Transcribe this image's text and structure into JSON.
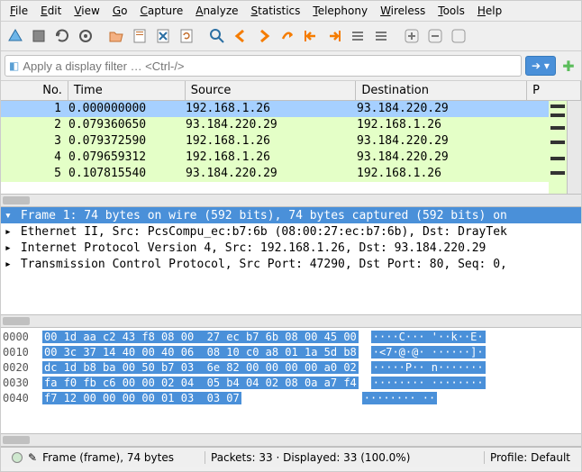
{
  "menu": [
    "File",
    "Edit",
    "View",
    "Go",
    "Capture",
    "Analyze",
    "Statistics",
    "Telephony",
    "Wireless",
    "Tools",
    "Help"
  ],
  "toolbar_icons": [
    "fin-icon",
    "stop-icon",
    "restart-icon",
    "options-icon",
    "open-icon",
    "save-icon",
    "close-icon",
    "reload-icon",
    "find-icon",
    "prev-icon",
    "next-icon",
    "jump-icon",
    "first-icon",
    "last-icon",
    "autoscroll-icon",
    "colorize-icon",
    "zoom-in-icon",
    "zoom-out-icon",
    "zoom-reset-icon"
  ],
  "filter": {
    "placeholder": "Apply a display filter … <Ctrl-/>"
  },
  "columns": {
    "no": "No.",
    "time": "Time",
    "src": "Source",
    "dst": "Destination",
    "proto": "P"
  },
  "packets": [
    {
      "no": "1",
      "time": "0.000000000",
      "src": "192.168.1.26",
      "dst": "93.184.220.29",
      "sel": true
    },
    {
      "no": "2",
      "time": "0.079360650",
      "src": "93.184.220.29",
      "dst": "192.168.1.26",
      "sel": false
    },
    {
      "no": "3",
      "time": "0.079372590",
      "src": "192.168.1.26",
      "dst": "93.184.220.29",
      "sel": false
    },
    {
      "no": "4",
      "time": "0.079659312",
      "src": "192.168.1.26",
      "dst": "93.184.220.29",
      "sel": false
    },
    {
      "no": "5",
      "time": "0.107815540",
      "src": "93.184.220.29",
      "dst": "192.168.1.26",
      "sel": false
    }
  ],
  "details": [
    {
      "text": "Frame 1: 74 bytes on wire (592 bits), 74 bytes captured (592 bits) on",
      "sel": true,
      "exp": true
    },
    {
      "text": "Ethernet II, Src: PcsCompu_ec:b7:6b (08:00:27:ec:b7:6b), Dst: DrayTek",
      "sel": false,
      "exp": false
    },
    {
      "text": "Internet Protocol Version 4, Src: 192.168.1.26, Dst: 93.184.220.29",
      "sel": false,
      "exp": false
    },
    {
      "text": "Transmission Control Protocol, Src Port: 47290, Dst Port: 80, Seq: 0,",
      "sel": false,
      "exp": false
    }
  ],
  "bytes": [
    {
      "off": "0000",
      "hex": "00 1d aa c2 43 f8 08 00  27 ec b7 6b 08 00 45 00",
      "asc": "····C··· '··k··E·"
    },
    {
      "off": "0010",
      "hex": "00 3c 37 14 40 00 40 06  08 10 c0 a8 01 1a 5d b8",
      "asc": "·<7·@·@· ······]·"
    },
    {
      "off": "0020",
      "hex": "dc 1d b8 ba 00 50 b7 03  6e 82 00 00 00 00 a0 02",
      "asc": "·····P·· n·······"
    },
    {
      "off": "0030",
      "hex": "fa f0 fb c6 00 00 02 04  05 b4 04 02 08 0a a7 f4",
      "asc": "········ ········"
    },
    {
      "off": "0040",
      "hex": "f7 12 00 00 00 00 01 03  03 07",
      "asc": "········ ··",
      "short": true
    }
  ],
  "status": {
    "frame": "Frame (frame), 74 bytes",
    "packets": "Packets: 33 · Displayed: 33 (100.0%)",
    "profile": "Profile: Default"
  }
}
